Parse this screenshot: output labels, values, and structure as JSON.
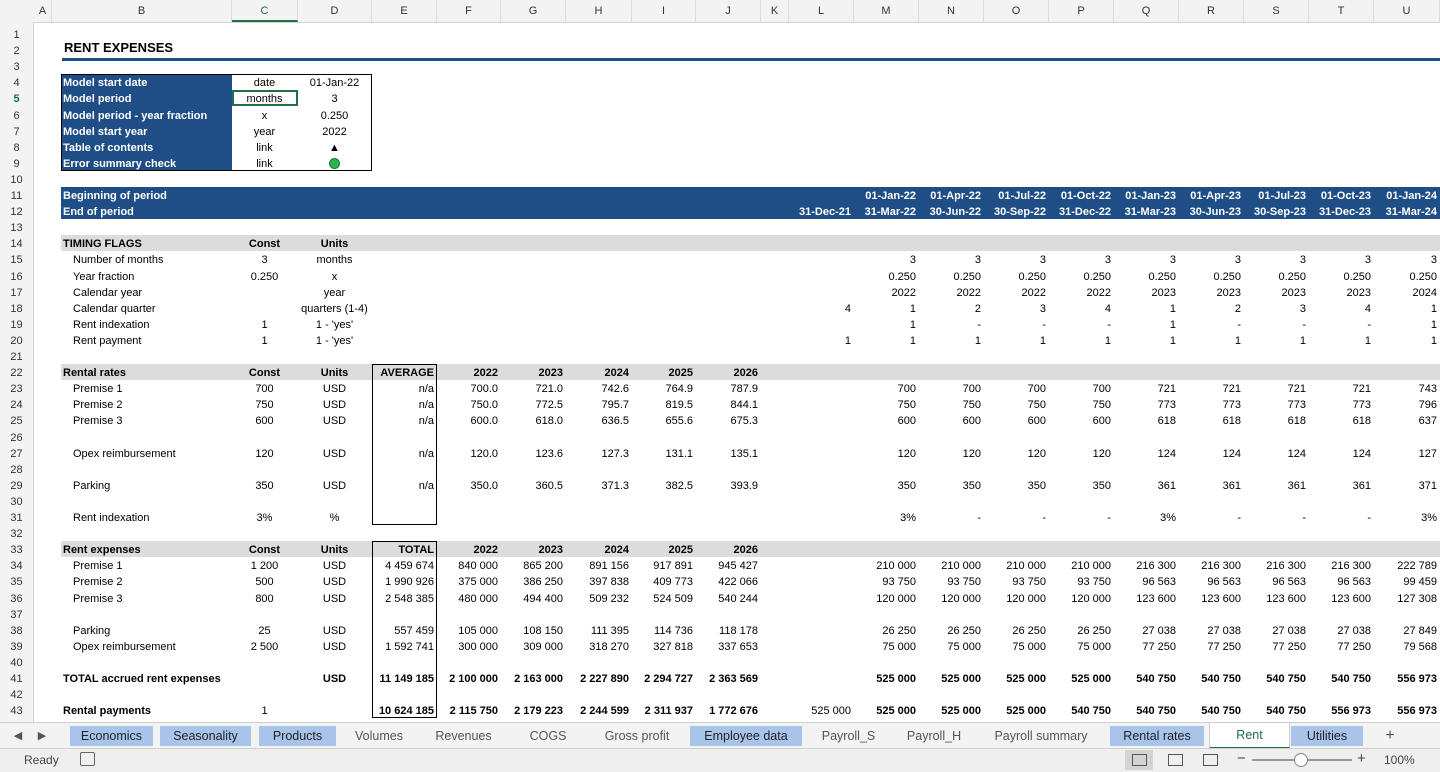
{
  "sheet_title": "RENT EXPENSES",
  "selected_cell": {
    "col": "C",
    "row": "5"
  },
  "columns": [
    "A",
    "B",
    "C",
    "D",
    "E",
    "F",
    "G",
    "H",
    "I",
    "J",
    "K",
    "L",
    "M",
    "N",
    "O",
    "P",
    "Q",
    "R",
    "S",
    "T",
    "U"
  ],
  "rows": [
    "1",
    "2",
    "3",
    "4",
    "5",
    "6",
    "7",
    "8",
    "9",
    "10",
    "11",
    "12",
    "13",
    "14",
    "15",
    "16",
    "17",
    "18",
    "19",
    "20",
    "21",
    "22",
    "23",
    "24",
    "25",
    "26",
    "27",
    "28",
    "29",
    "30",
    "31",
    "32",
    "33",
    "34",
    "35",
    "36",
    "37",
    "38",
    "39",
    "40",
    "41",
    "42",
    "43"
  ],
  "info_box": [
    {
      "label": "Model start date",
      "unit": "date",
      "value": "01-Jan-22"
    },
    {
      "label": "Model period",
      "unit": "months",
      "value": "3"
    },
    {
      "label": "Model period - year fraction",
      "unit": "x",
      "value": "0.250"
    },
    {
      "label": "Model start year",
      "unit": "year",
      "value": "2022"
    },
    {
      "label": "Table of contents",
      "unit": "link",
      "value": "▲"
    },
    {
      "label": "Error summary check",
      "unit": "link",
      "value": ""
    }
  ],
  "period_header": {
    "row1_label": "Beginning of period",
    "row2_label": "End of period",
    "L_end": "31-Dec-21",
    "begin": [
      "01-Jan-22",
      "01-Apr-22",
      "01-Jul-22",
      "01-Oct-22",
      "01-Jan-23",
      "01-Apr-23",
      "01-Jul-23",
      "01-Oct-23",
      "01-Jan-24"
    ],
    "end": [
      "31-Mar-22",
      "30-Jun-22",
      "30-Sep-22",
      "31-Dec-22",
      "31-Mar-23",
      "30-Jun-23",
      "30-Sep-23",
      "31-Dec-23",
      "31-Mar-24"
    ]
  },
  "timing": {
    "title": "TIMING FLAGS",
    "const_hdr": "Const",
    "units_hdr": "Units",
    "rows": [
      {
        "label": "Number of months",
        "const": "3",
        "units": "months",
        "L": "",
        "vals": [
          "3",
          "3",
          "3",
          "3",
          "3",
          "3",
          "3",
          "3",
          "3"
        ]
      },
      {
        "label": "Year fraction",
        "const": "0.250",
        "units": "x",
        "L": "",
        "vals": [
          "0.250",
          "0.250",
          "0.250",
          "0.250",
          "0.250",
          "0.250",
          "0.250",
          "0.250",
          "0.250"
        ]
      },
      {
        "label": "Calendar year",
        "const": "",
        "units": "year",
        "L": "",
        "vals": [
          "2022",
          "2022",
          "2022",
          "2022",
          "2023",
          "2023",
          "2023",
          "2023",
          "2024"
        ]
      },
      {
        "label": "Calendar quarter",
        "const": "",
        "units": "quarters (1-4)",
        "L": "4",
        "vals": [
          "1",
          "2",
          "3",
          "4",
          "1",
          "2",
          "3",
          "4",
          "1"
        ]
      },
      {
        "label": "Rent indexation",
        "const": "1",
        "units": "1 - 'yes'",
        "L": "",
        "vals": [
          "1",
          "-",
          "-",
          "-",
          "1",
          "-",
          "-",
          "-",
          "1"
        ]
      },
      {
        "label": "Rent payment",
        "const": "1",
        "units": "1 - 'yes'",
        "L": "1",
        "vals": [
          "1",
          "1",
          "1",
          "1",
          "1",
          "1",
          "1",
          "1",
          "1"
        ]
      }
    ]
  },
  "rental_rates": {
    "title": "Rental rates",
    "const_hdr": "Const",
    "units_hdr": "Units",
    "agg_hdr": "AVERAGE",
    "years": [
      "2022",
      "2023",
      "2024",
      "2025",
      "2026"
    ],
    "rows": [
      {
        "row": 23,
        "label": "Premise 1",
        "const": "700",
        "units": "USD",
        "agg": "n/a",
        "years": [
          "700.0",
          "721.0",
          "742.6",
          "764.9",
          "787.9"
        ],
        "L": "",
        "vals": [
          "700",
          "700",
          "700",
          "700",
          "721",
          "721",
          "721",
          "721",
          "743"
        ]
      },
      {
        "row": 24,
        "label": "Premise 2",
        "const": "750",
        "units": "USD",
        "agg": "n/a",
        "years": [
          "750.0",
          "772.5",
          "795.7",
          "819.5",
          "844.1"
        ],
        "L": "",
        "vals": [
          "750",
          "750",
          "750",
          "750",
          "773",
          "773",
          "773",
          "773",
          "796"
        ]
      },
      {
        "row": 25,
        "label": "Premise 3",
        "const": "600",
        "units": "USD",
        "agg": "n/a",
        "years": [
          "600.0",
          "618.0",
          "636.5",
          "655.6",
          "675.3"
        ],
        "L": "",
        "vals": [
          "600",
          "600",
          "600",
          "600",
          "618",
          "618",
          "618",
          "618",
          "637"
        ]
      },
      {
        "row": 27,
        "label": "Opex reimbursement",
        "const": "120",
        "units": "USD",
        "agg": "n/a",
        "years": [
          "120.0",
          "123.6",
          "127.3",
          "131.1",
          "135.1"
        ],
        "L": "",
        "vals": [
          "120",
          "120",
          "120",
          "120",
          "124",
          "124",
          "124",
          "124",
          "127"
        ]
      },
      {
        "row": 29,
        "label": "Parking",
        "const": "350",
        "units": "USD",
        "agg": "n/a",
        "years": [
          "350.0",
          "360.5",
          "371.3",
          "382.5",
          "393.9"
        ],
        "L": "",
        "vals": [
          "350",
          "350",
          "350",
          "350",
          "361",
          "361",
          "361",
          "361",
          "371"
        ]
      },
      {
        "row": 31,
        "label": "Rent indexation",
        "const": "3%",
        "units": "%",
        "agg": "",
        "years": [
          "",
          "",
          "",
          "",
          ""
        ],
        "L": "",
        "vals": [
          "3%",
          "-",
          "-",
          "-",
          "3%",
          "-",
          "-",
          "-",
          "3%"
        ]
      }
    ]
  },
  "rent_expenses": {
    "title": "Rent expenses",
    "const_hdr": "Const",
    "units_hdr": "Units",
    "agg_hdr": "TOTAL",
    "years": [
      "2022",
      "2023",
      "2024",
      "2025",
      "2026"
    ],
    "rows": [
      {
        "row": 34,
        "label": "Premise 1",
        "const": "1 200",
        "units": "USD",
        "agg": "4 459 674",
        "years": [
          "840 000",
          "865 200",
          "891 156",
          "917 891",
          "945 427"
        ],
        "L": "",
        "vals": [
          "210 000",
          "210 000",
          "210 000",
          "210 000",
          "216 300",
          "216 300",
          "216 300",
          "216 300",
          "222 789"
        ],
        "bold": false
      },
      {
        "row": 35,
        "label": "Premise 2",
        "const": "500",
        "units": "USD",
        "agg": "1 990 926",
        "years": [
          "375 000",
          "386 250",
          "397 838",
          "409 773",
          "422 066"
        ],
        "L": "",
        "vals": [
          "93 750",
          "93 750",
          "93 750",
          "93 750",
          "96 563",
          "96 563",
          "96 563",
          "96 563",
          "99 459"
        ],
        "bold": false
      },
      {
        "row": 36,
        "label": "Premise 3",
        "const": "800",
        "units": "USD",
        "agg": "2 548 385",
        "years": [
          "480 000",
          "494 400",
          "509 232",
          "524 509",
          "540 244"
        ],
        "L": "",
        "vals": [
          "120 000",
          "120 000",
          "120 000",
          "120 000",
          "123 600",
          "123 600",
          "123 600",
          "123 600",
          "127 308"
        ],
        "bold": false
      },
      {
        "row": 38,
        "label": "Parking",
        "const": "25",
        "units": "USD",
        "agg": "557 459",
        "years": [
          "105 000",
          "108 150",
          "111 395",
          "114 736",
          "118 178"
        ],
        "L": "",
        "vals": [
          "26 250",
          "26 250",
          "26 250",
          "26 250",
          "27 038",
          "27 038",
          "27 038",
          "27 038",
          "27 849"
        ],
        "bold": false
      },
      {
        "row": 39,
        "label": "Opex reimbursement",
        "const": "2 500",
        "units": "USD",
        "agg": "1 592 741",
        "years": [
          "300 000",
          "309 000",
          "318 270",
          "327 818",
          "337 653"
        ],
        "L": "",
        "vals": [
          "75 000",
          "75 000",
          "75 000",
          "75 000",
          "77 250",
          "77 250",
          "77 250",
          "77 250",
          "79 568"
        ],
        "bold": false
      },
      {
        "row": 41,
        "label": "TOTAL accrued rent expenses",
        "const": "",
        "units": "USD",
        "agg": "11 149 185",
        "years": [
          "2 100 000",
          "2 163 000",
          "2 227 890",
          "2 294 727",
          "2 363 569"
        ],
        "L": "",
        "vals": [
          "525 000",
          "525 000",
          "525 000",
          "525 000",
          "540 750",
          "540 750",
          "540 750",
          "540 750",
          "556 973"
        ],
        "bold": true
      },
      {
        "row": 43,
        "label": "Rental payments",
        "const": "1",
        "units": "",
        "agg": "10 624 185",
        "years": [
          "2 115 750",
          "2 179 223",
          "2 244 599",
          "2 311 937",
          "1 772 676"
        ],
        "L": "525 000",
        "vals": [
          "525 000",
          "525 000",
          "525 000",
          "540 750",
          "540 750",
          "540 750",
          "540 750",
          "556 973",
          "556 973"
        ],
        "bold": true
      }
    ]
  },
  "tabs": [
    {
      "label": "Economics",
      "colored": true,
      "active": false
    },
    {
      "label": "Seasonality",
      "colored": true,
      "active": false
    },
    {
      "label": "Products",
      "colored": true,
      "active": false
    },
    {
      "label": "Volumes",
      "colored": false,
      "active": false
    },
    {
      "label": "Revenues",
      "colored": false,
      "active": false
    },
    {
      "label": "COGS",
      "colored": false,
      "active": false
    },
    {
      "label": "Gross profit",
      "colored": false,
      "active": false
    },
    {
      "label": "Employee data",
      "colored": true,
      "active": false
    },
    {
      "label": "Payroll_S",
      "colored": false,
      "active": false
    },
    {
      "label": "Payroll_H",
      "colored": false,
      "active": false
    },
    {
      "label": "Payroll summary",
      "colored": false,
      "active": false
    },
    {
      "label": "Rental rates",
      "colored": true,
      "active": false
    },
    {
      "label": "Rent",
      "colored": false,
      "active": true
    },
    {
      "label": "Utilities",
      "colored": true,
      "active": false
    }
  ],
  "add_sheet": "+",
  "status": {
    "ready": "Ready",
    "zoom": "100%"
  },
  "colors": {
    "accent_blue": "#1f4e86",
    "band_gray": "#dcdcdc",
    "tab_blue": "#a9c4ea",
    "ok_green": "#2fb34a"
  }
}
